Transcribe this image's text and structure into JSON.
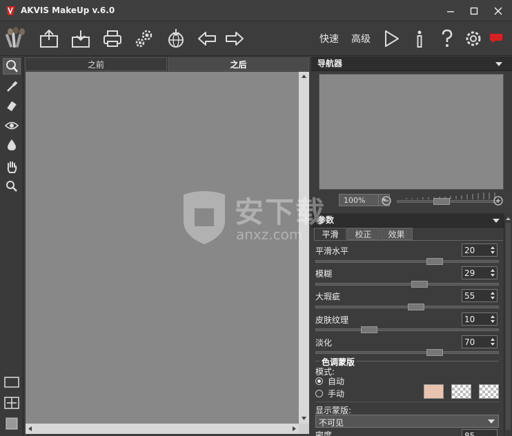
{
  "window": {
    "title": "AKVIS MakeUp v.6.0"
  },
  "toolbar": {
    "quick_label": "快速",
    "advanced_label": "高级"
  },
  "image_area": {
    "tab_before": "之前",
    "tab_after": "之后"
  },
  "navigator": {
    "title": "导航器",
    "zoom": "100%"
  },
  "params": {
    "title": "参数",
    "tabs": [
      "平滑",
      "校正",
      "效果"
    ],
    "items": [
      {
        "label": "平滑水平",
        "value": "20",
        "fraction": 0.66
      },
      {
        "label": "模糊",
        "value": "29",
        "fraction": 0.57
      },
      {
        "label": "大瑕疵",
        "value": "55",
        "fraction": 0.55
      },
      {
        "label": "皮肤纹理",
        "value": "10",
        "fraction": 0.27
      },
      {
        "label": "淡化",
        "value": "70",
        "fraction": 0.66
      }
    ]
  },
  "tone_mask": {
    "title": "色调蒙版",
    "mode_label": "模式:",
    "auto_label": "自动",
    "manual_label": "手动",
    "swatch_color": "#e8c4b0",
    "show_mask_label": "显示蒙版:",
    "show_mask_value": "不可见",
    "density_label": "密度",
    "density_value": "85"
  },
  "watermark": {
    "text": "安下载",
    "sub": "anxz.com"
  },
  "colors": {
    "bg": "#3c3c3c",
    "canvas": "#888888",
    "accent_red": "#d42222"
  }
}
